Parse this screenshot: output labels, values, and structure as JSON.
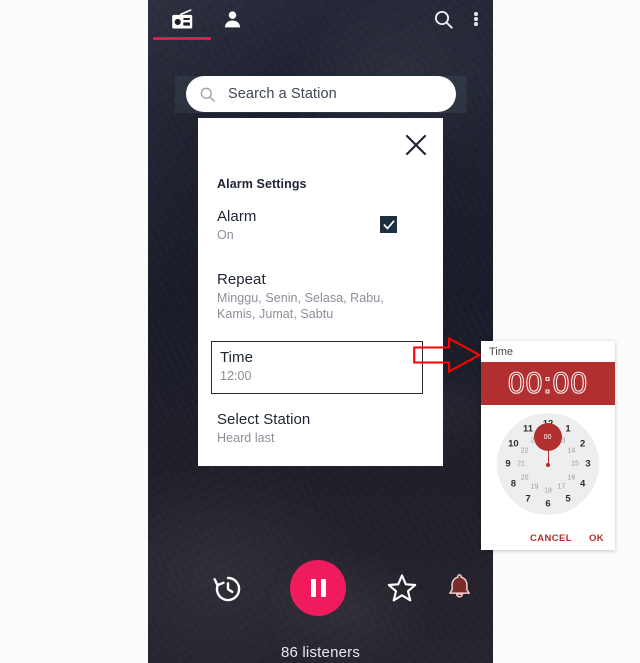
{
  "app": {
    "tabs": [
      {
        "name": "radio-tab",
        "icon": "radio-icon",
        "selected": true
      },
      {
        "name": "profile-tab",
        "icon": "person-icon",
        "selected": false
      }
    ],
    "actions": [
      {
        "name": "search-action",
        "icon": "search-icon"
      },
      {
        "name": "overflow-action",
        "icon": "more-vertical-icon"
      }
    ],
    "accent_color": "#e8174c",
    "background_color": "#1b1e2b"
  },
  "search": {
    "placeholder": "Search a Station",
    "value": "",
    "icon": "search-icon"
  },
  "alarm_dialog": {
    "title": "Alarm Settings",
    "close_icon": "close-icon",
    "rows": [
      {
        "label": "Alarm",
        "value": "On",
        "control": "checkbox",
        "checked": true
      },
      {
        "label": "Repeat",
        "value": "Minggu, Senin, Selasa, Rabu, Kamis, Jumat, Sabtu"
      },
      {
        "label": "Time",
        "value": "12:00",
        "highlighted": true
      },
      {
        "label": "Select Station",
        "value": "Heard last"
      }
    ]
  },
  "player": {
    "history_icon": "history-clock-icon",
    "play_pause_icon": "pause-icon",
    "favorite_icon": "star-outline-icon",
    "alarm_icon": "bell-icon",
    "listeners_text": "86 listeners",
    "play_button_color": "#ef1b5c",
    "alarm_icon_color": "#7a2b2b"
  },
  "time_picker": {
    "label": "Time",
    "display_time": "00:00",
    "banner_color": "#b22f2f",
    "outer_hours": [
      "12",
      "1",
      "2",
      "3",
      "4",
      "5",
      "6",
      "7",
      "8",
      "9",
      "10",
      "11"
    ],
    "inner_hours": [
      "00",
      "13",
      "14",
      "15",
      "16",
      "17",
      "18",
      "19",
      "20",
      "21",
      "22",
      "23"
    ],
    "selected_hour": "00",
    "cancel_label": "CANCEL",
    "ok_label": "OK",
    "action_color": "#b22f2f"
  },
  "annotation": {
    "arrow_name": "red-pointer-arrow",
    "arrow_color": "#ff0000",
    "direction": "right"
  }
}
